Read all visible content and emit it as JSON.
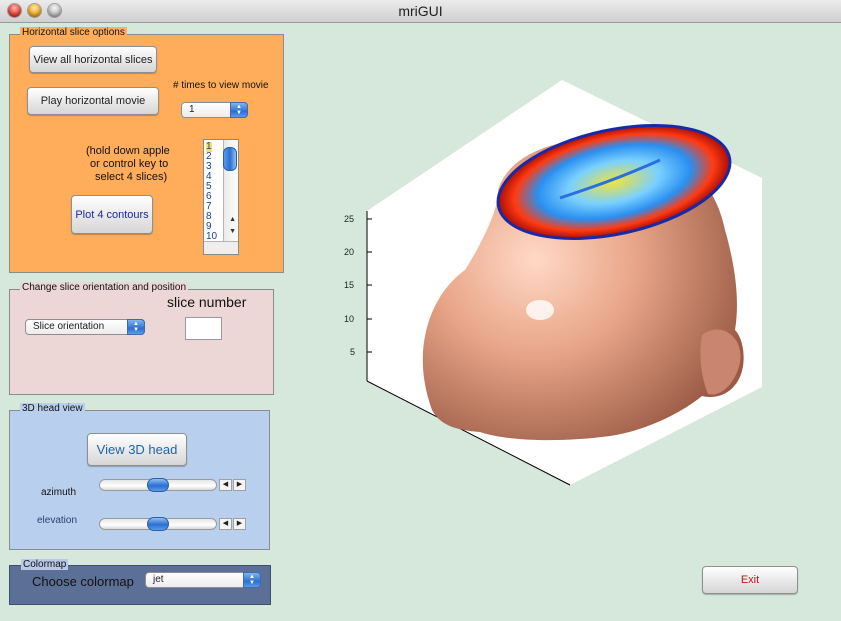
{
  "window": {
    "title": "mriGUI"
  },
  "horizontal_panel": {
    "title": "Horizontal slice options",
    "view_all_label": "View all horizontal slices",
    "play_label": "Play horizontal movie",
    "times_label": "# times to view movie",
    "times_value": "1",
    "hint_lines": [
      "(hold down apple",
      "or control key to",
      "select 4 slices)"
    ],
    "plot4_label": "Plot 4 contours",
    "slice_list": [
      "1",
      "2",
      "3",
      "4",
      "5",
      "6",
      "7",
      "8",
      "9",
      "10"
    ],
    "slice_list_selected": "1"
  },
  "orientation_panel": {
    "title": "Change slice orientation and position",
    "orientation_value": "Slice orientation",
    "slice_number_label": "slice number",
    "slice_number_value": ""
  },
  "head_panel": {
    "title": "3D head view",
    "view3d_label": "View 3D head",
    "azimuth_label": "azimuth",
    "elevation_label": "elevation",
    "azimuth_position": 0.5,
    "elevation_position": 0.5
  },
  "colormap_panel": {
    "title": "Colormap",
    "choose_label": "Choose colormap",
    "value": "jet"
  },
  "exit_label": "Exit",
  "axes": {
    "z_ticks": [
      "25",
      "20",
      "15",
      "10",
      "5"
    ]
  },
  "colors": {
    "orange_panel": "#ffad5b",
    "pink_panel": "#ecd6d6",
    "blue_panel": "#b8d0ee",
    "colormap_panel": "#5c6f96",
    "background": "#d6e8dc",
    "exit_text": "#c01818"
  }
}
